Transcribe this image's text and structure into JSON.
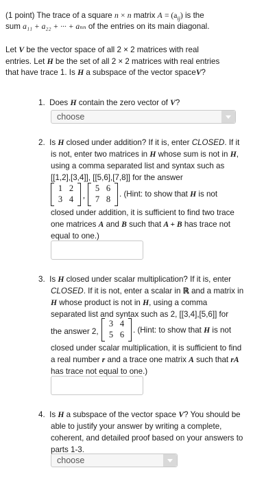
{
  "intro": {
    "points": "(1 point)",
    "p1_a": "The trace of a square",
    "n": "n",
    "times": "×",
    "p1_b": "matrix",
    "A": "A",
    "eq": "= (a",
    "ij": "ij",
    "close": ")",
    "p1_c": "is the",
    "sum_label": "sum",
    "sum_expr": "a₁₁ + a₂₂ + ··· + aₙₙ",
    "p1_d": "of the entries on its main diagonal.",
    "p2_line1_a": "Let",
    "V": "V",
    "p2_line1_b": "be the vector space of all 2 × 2 matrices with real",
    "p2_line2_a": "entries. Let",
    "H": "H",
    "p2_line2_b": "be the set of all 2 × 2 matrices with real entries",
    "p2_line3_a": "that have trace 1. Is",
    "p2_line3_b": "a subspace of the vector space",
    "p2_line3_c": "?"
  },
  "q1": {
    "num": "1.",
    "text_a": "Does",
    "text_b": "contain the zero vector of",
    "text_c": "?",
    "select_value": "choose"
  },
  "q2": {
    "num": "2.",
    "l1a": "Is",
    "l1b": "closed under addition? If it is, enter",
    "l1c": "CLOSED",
    "l1d": ". If it",
    "l2a": "is not, enter two matrices in",
    "l2b": "whose sum is not in",
    "l2c": ",",
    "l3": "using a comma separated list and syntax such as",
    "l4": "[[1,2],[3,4]], [[5,6],[7,8]] for the answer",
    "m1": [
      "1",
      "2",
      "3",
      "4"
    ],
    "m2": [
      "5",
      "6",
      "7",
      "8"
    ],
    "comma": ",",
    "hint_a": ". (Hint: to show that",
    "hint_b": "is not",
    "l6": "closed under addition, it is sufficient to find two trace",
    "l7a": "one matrices",
    "A": "A",
    "and": "and",
    "B": "B",
    "l7b": "such that",
    "AB": "A + B",
    "l7c": "has trace not",
    "l8": "equal to one.)"
  },
  "q3": {
    "num": "3.",
    "l1a": "Is",
    "l1b": "closed under scalar multiplication? If it is, enter",
    "l2a": "CLOSED",
    "l2b": ". If it is not, enter a scalar in",
    "R": "ℝ",
    "l2c": "and a matrix in",
    "l3a": "whose product is not in",
    "l3b": ", using a comma",
    "l4": "separated list and syntax such as 2, [[3,4],[5,6]] for",
    "l5a": "the answer 2,",
    "m": [
      "3",
      "4",
      "5",
      "6"
    ],
    "hint_a": ". (Hint: to show that",
    "hint_b": "is not",
    "l6": "closed under scalar multiplication, it is sufficient to find",
    "l7a": "a real number",
    "r": "r",
    "l7b": "and a trace one matrix",
    "A": "A",
    "l7c": "such that",
    "rA": "rA",
    "l8": "has trace not equal to one.)"
  },
  "q4": {
    "num": "4.",
    "l1a": "Is",
    "l1b": "a subspace of the vector space",
    "l1c": "? You should be",
    "l2": "able to justify your answer by writing a complete,",
    "l3": "coherent, and detailed proof based on your answers to",
    "l4": "parts 1-3.",
    "select_value": "choose"
  }
}
